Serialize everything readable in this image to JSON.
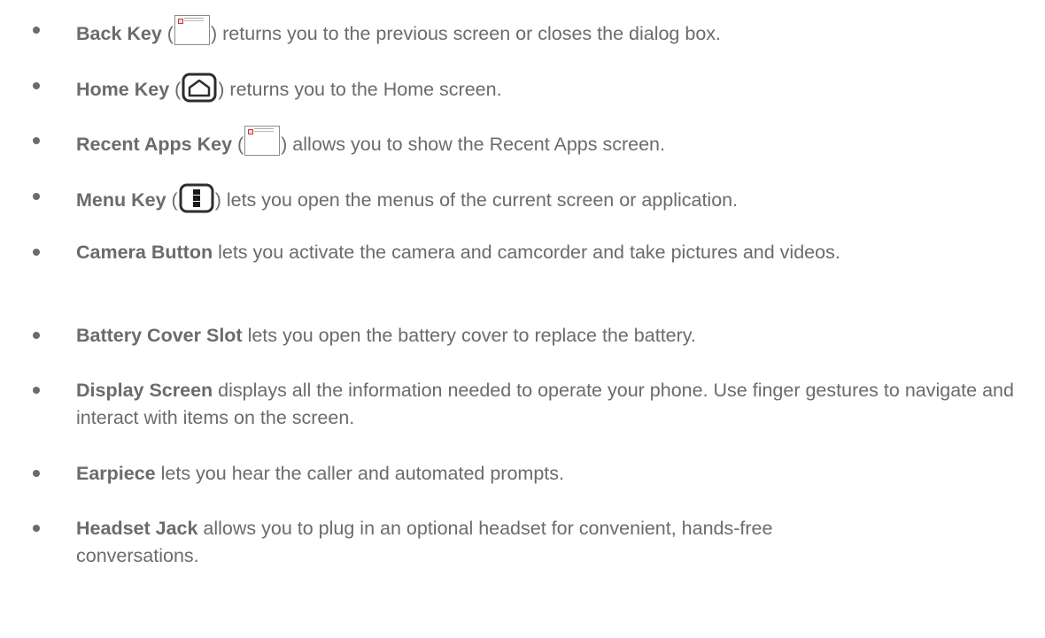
{
  "items": [
    {
      "term": "Back Key",
      "pre": " (",
      "post": ") returns you to the previous screen or closes the dialog box.",
      "icon": "broken-image-icon"
    },
    {
      "term": "Home Key",
      "pre": " (",
      "post": ") returns you to the Home screen.",
      "icon": "home-icon"
    },
    {
      "term": "Recent Apps Key",
      "pre": " (",
      "post": ") allows you to show the Recent Apps screen.",
      "icon": "broken-image-icon"
    },
    {
      "term": "Menu Key",
      "pre": " (",
      "post": ") lets you open the menus of the current screen or application.",
      "icon": "menu-icon"
    },
    {
      "term": "Camera Button",
      "text": " lets you activate the camera and camcorder and take pictures and videos."
    },
    {
      "term": "Battery Cover Slot",
      "text": " lets you open the battery cover to replace the battery."
    },
    {
      "term": "Display Screen",
      "text": " displays all the information needed to operate your phone. Use finger gestures to navigate and interact with items on the screen."
    },
    {
      "term": "Earpiece",
      "text": " lets you hear the caller and automated prompts."
    },
    {
      "term": "Headset Jack",
      "text": " allows you to plug in an optional headset for convenient, hands-free conversations."
    }
  ]
}
